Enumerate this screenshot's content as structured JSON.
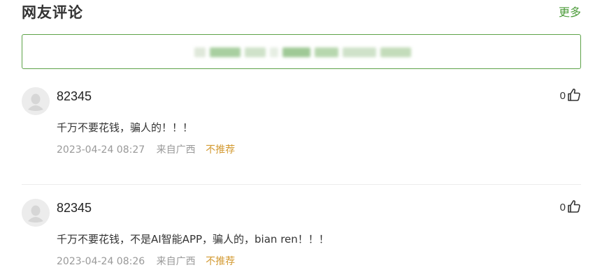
{
  "header": {
    "title": "网友评论",
    "more_label": "更多"
  },
  "comment_input": {
    "placeholder": ""
  },
  "colors": {
    "accent_green": "#4d9c3b",
    "not_recommend_orange": "#d39a32"
  },
  "comments": [
    {
      "username": "82345",
      "likes": "0",
      "content": "千万不要花钱，骗人的！！！",
      "time": "2023-04-24 08:27",
      "location": "来自广西",
      "not_recommend": "不推荐"
    },
    {
      "username": "82345",
      "likes": "0",
      "content": "千万不要花钱，不是AI智能APP，骗人的，bian ren！！！",
      "time": "2023-04-24 08:26",
      "location": "来自广西",
      "not_recommend": "不推荐"
    }
  ],
  "icons": {
    "avatar": "default-avatar-icon",
    "like": "thumbs-up-icon"
  }
}
